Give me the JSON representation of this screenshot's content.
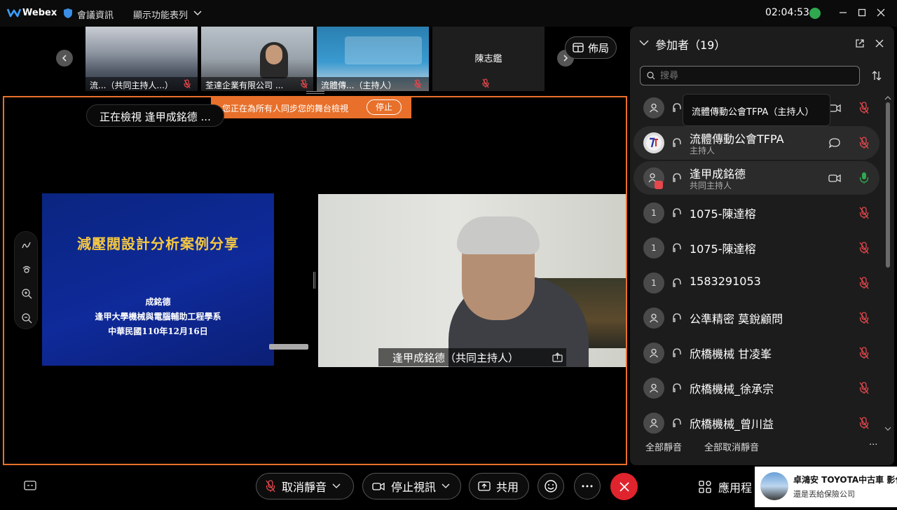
{
  "titlebar": {
    "app_name": "Webex",
    "meeting_info": "會議資訊",
    "view_menu": "顯示功能表列",
    "clock": "02:04:53"
  },
  "thumbnails": [
    {
      "label": "流...（共同主持人...）"
    },
    {
      "label": "荃達企業有限公司 ..."
    },
    {
      "label": "流體傳...（主持人）"
    },
    {
      "label": "陳志鑑"
    }
  ],
  "layout_button": "佈局",
  "stage": {
    "sync_message": "您正在為所有人同步您的舞台檢視",
    "sync_stop": "停止",
    "viewing": "正在檢視 逢甲成銘德 ...",
    "slide": {
      "title": "減壓閥設計分析案例分享",
      "line1": "成銘德",
      "line2": "逢甲大學機械與電腦輔助工程學系",
      "line3": "中華民國110年12月16日"
    },
    "video_label": "逢甲成銘德（共同主持人）"
  },
  "panel": {
    "title": "參加者（19）",
    "search_placeholder": "搜尋",
    "tooltip": "流體傳動公會TFPA（主持人）",
    "participants": [
      {
        "avatar": "",
        "name": "",
        "role": ""
      },
      {
        "avatar": "",
        "name": "流體傳動公會TFPA",
        "role": "主持人"
      },
      {
        "avatar": "",
        "name": "逢甲成銘德",
        "role": "共同主持人"
      },
      {
        "avatar": "1",
        "name": "1075-陳達榕",
        "role": ""
      },
      {
        "avatar": "1",
        "name": "1075-陳達榕",
        "role": ""
      },
      {
        "avatar": "1",
        "name": "1583291053",
        "role": ""
      },
      {
        "avatar": "",
        "name": "公準精密 莫銳顧問",
        "role": ""
      },
      {
        "avatar": "",
        "name": "欣橋機械 甘凌峯",
        "role": ""
      },
      {
        "avatar": "",
        "name": "欣橋機械_徐承宗",
        "role": ""
      },
      {
        "avatar": "",
        "name": "欣橋機械_曾川益",
        "role": ""
      }
    ],
    "mute_all": "全部靜音",
    "unmute_all": "全部取消靜音",
    "more": "···"
  },
  "toolbar": {
    "unmute": "取消靜音",
    "stop_video": "停止視訊",
    "share": "共用",
    "apps": "應用程"
  },
  "ad": {
    "line1": "卓鴻安 TOYOTA中古車 影化",
    "line2": "還是丟給保險公司"
  },
  "colors": {
    "accent_orange": "#e8702a",
    "leave_red": "#e0242d",
    "slide_title_gold": "#f5c842",
    "muted_red": "#e5484d",
    "unmuted_green": "#2fa84f"
  }
}
